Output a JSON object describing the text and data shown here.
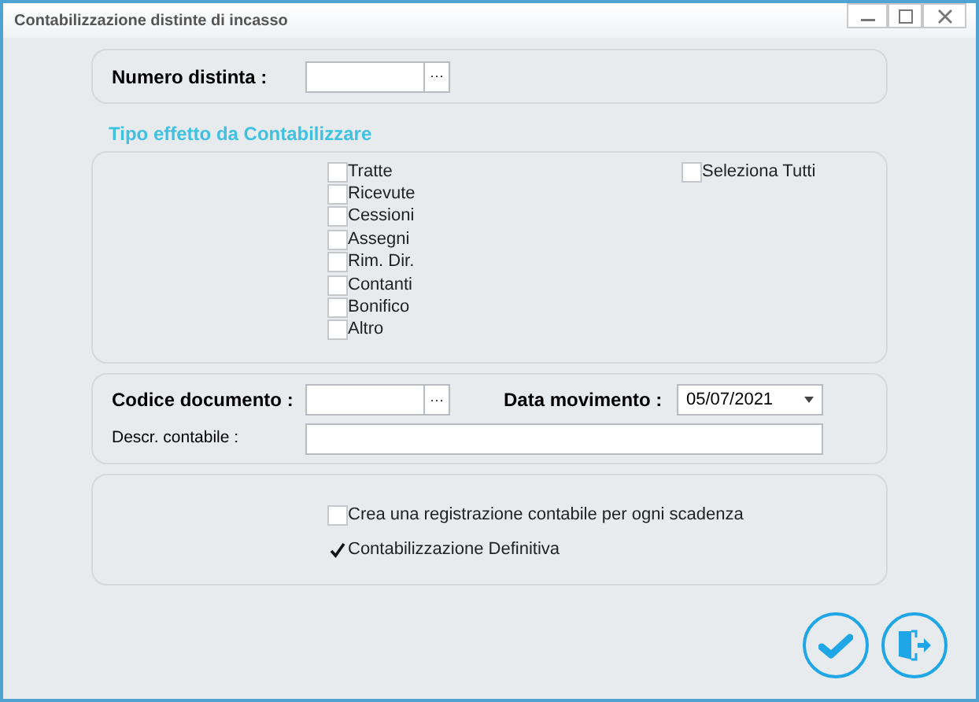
{
  "window": {
    "title": "Contabilizzazione distinte di incasso"
  },
  "numero_distinta": {
    "label": "Numero distinta :",
    "browse": "···"
  },
  "tipo_effetto": {
    "title": "Tipo effetto da Contabilizzare",
    "options": [
      {
        "label": "Tratte",
        "checked": false
      },
      {
        "label": "Ricevute",
        "checked": false
      },
      {
        "label": "Cessioni",
        "checked": false
      },
      {
        "label": "Assegni",
        "checked": false
      },
      {
        "label": "Rim. Dir.",
        "checked": false
      },
      {
        "label": "Contanti",
        "checked": false
      },
      {
        "label": "Bonifico",
        "checked": false
      },
      {
        "label": "Altro",
        "checked": false
      }
    ],
    "select_all": {
      "label": "Seleziona Tutti",
      "checked": false
    }
  },
  "documento": {
    "codice_label": "Codice documento :",
    "browse": "···",
    "data_label": "Data movimento :",
    "data_value": "05/07/2021",
    "descr_label": "Descr. contabile :"
  },
  "opzioni": [
    {
      "label": "Crea una registrazione contabile per ogni scadenza",
      "checked": false
    },
    {
      "label": "Contabilizzazione Definitiva",
      "checked": true
    }
  ]
}
